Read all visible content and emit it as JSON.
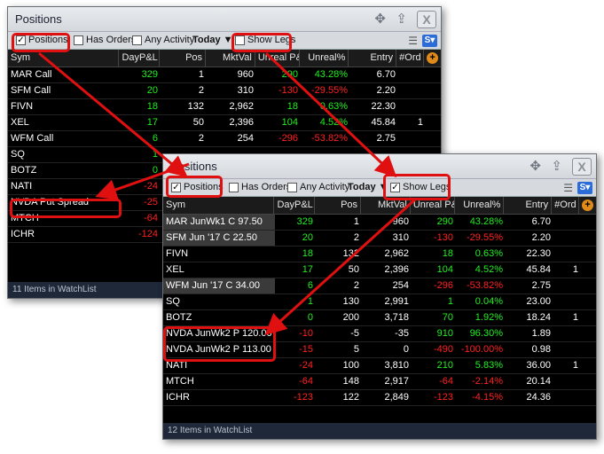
{
  "panels": [
    {
      "title": "Positions",
      "options": {
        "positions": "Positions",
        "has_orders": "Has Orders",
        "any_activity": "Any Activity",
        "today": "Today",
        "show_legs": "Show Legs"
      },
      "columns": [
        "Sym",
        "DayP&L",
        "Pos",
        "MktVal",
        "Unreal P&L",
        "Unreal%",
        "Entry",
        "#Ord"
      ],
      "rows": [
        {
          "sym": "MAR Call",
          "day": "329",
          "pos": "1",
          "mkt": "960",
          "upl": "290",
          "upct": "43.28%",
          "entry": "6.70",
          "ord": ""
        },
        {
          "sym": "SFM Call",
          "day": "20",
          "pos": "2",
          "mkt": "310",
          "upl": "-130",
          "upct": "-29.55%",
          "entry": "2.20",
          "ord": ""
        },
        {
          "sym": "FIVN",
          "day": "18",
          "pos": "132",
          "mkt": "2,962",
          "upl": "18",
          "upct": "0.63%",
          "entry": "22.30",
          "ord": ""
        },
        {
          "sym": "XEL",
          "day": "17",
          "pos": "50",
          "mkt": "2,396",
          "upl": "104",
          "upct": "4.52%",
          "entry": "45.84",
          "ord": "1"
        },
        {
          "sym": "WFM Call",
          "day": "6",
          "pos": "2",
          "mkt": "254",
          "upl": "-296",
          "upct": "-53.82%",
          "entry": "2.75",
          "ord": ""
        },
        {
          "sym": "SQ",
          "day": "1",
          "pos": "",
          "mkt": "",
          "upl": "",
          "upct": "",
          "entry": "",
          "ord": ""
        },
        {
          "sym": "BOTZ",
          "day": "0",
          "pos": "",
          "mkt": "",
          "upl": "",
          "upct": "",
          "entry": "",
          "ord": ""
        },
        {
          "sym": "NATI",
          "day": "-24",
          "pos": "",
          "mkt": "",
          "upl": "",
          "upct": "",
          "entry": "",
          "ord": ""
        },
        {
          "sym": "NVDA Put Spread",
          "day": "-25",
          "pos": "",
          "mkt": "",
          "upl": "",
          "upct": "",
          "entry": "",
          "ord": ""
        },
        {
          "sym": "MTCH",
          "day": "-64",
          "pos": "",
          "mkt": "",
          "upl": "",
          "upct": "",
          "entry": "",
          "ord": ""
        },
        {
          "sym": "ICHR",
          "day": "-124",
          "pos": "",
          "mkt": "",
          "upl": "",
          "upct": "",
          "entry": "",
          "ord": ""
        }
      ],
      "footer": "11 Items in WatchList"
    },
    {
      "title": "Positions",
      "options": {
        "positions": "Positions",
        "has_orders": "Has Orders",
        "any_activity": "Any Activity",
        "today": "Today",
        "show_legs": "Show Legs"
      },
      "columns": [
        "Sym",
        "DayP&L",
        "Pos",
        "MktVal",
        "Unreal P&L",
        "Unreal%",
        "Entry",
        "#Ord"
      ],
      "rows": [
        {
          "sym": "MAR JunWk1 C 97.50",
          "day": "329",
          "pos": "1",
          "mkt": "960",
          "upl": "290",
          "upct": "43.28%",
          "entry": "6.70",
          "ord": ""
        },
        {
          "sym": "SFM Jun '17 C 22.50",
          "day": "20",
          "pos": "2",
          "mkt": "310",
          "upl": "-130",
          "upct": "-29.55%",
          "entry": "2.20",
          "ord": ""
        },
        {
          "sym": "FIVN",
          "day": "18",
          "pos": "132",
          "mkt": "2,962",
          "upl": "18",
          "upct": "0.63%",
          "entry": "22.30",
          "ord": ""
        },
        {
          "sym": "XEL",
          "day": "17",
          "pos": "50",
          "mkt": "2,396",
          "upl": "104",
          "upct": "4.52%",
          "entry": "45.84",
          "ord": "1"
        },
        {
          "sym": "WFM Jun '17 C 34.00",
          "day": "6",
          "pos": "2",
          "mkt": "254",
          "upl": "-296",
          "upct": "-53.82%",
          "entry": "2.75",
          "ord": ""
        },
        {
          "sym": "SQ",
          "day": "1",
          "pos": "130",
          "mkt": "2,991",
          "upl": "1",
          "upct": "0.04%",
          "entry": "23.00",
          "ord": ""
        },
        {
          "sym": "BOTZ",
          "day": "0",
          "pos": "200",
          "mkt": "3,718",
          "upl": "70",
          "upct": "1.92%",
          "entry": "18.24",
          "ord": "1"
        },
        {
          "sym": "NVDA JunWk2 P 120.00",
          "day": "-10",
          "pos": "-5",
          "mkt": "-35",
          "upl": "910",
          "upct": "96.30%",
          "entry": "1.89",
          "ord": ""
        },
        {
          "sym": "NVDA JunWk2 P 113.00",
          "day": "-15",
          "pos": "5",
          "mkt": "0",
          "upl": "-490",
          "upct": "-100.00%",
          "entry": "0.98",
          "ord": ""
        },
        {
          "sym": "NATI",
          "day": "-24",
          "pos": "100",
          "mkt": "3,810",
          "upl": "210",
          "upct": "5.83%",
          "entry": "36.00",
          "ord": "1"
        },
        {
          "sym": "MTCH",
          "day": "-64",
          "pos": "148",
          "mkt": "2,917",
          "upl": "-64",
          "upct": "-2.14%",
          "entry": "20.14",
          "ord": ""
        },
        {
          "sym": "ICHR",
          "day": "-123",
          "pos": "122",
          "mkt": "2,849",
          "upl": "-123",
          "upct": "-4.15%",
          "entry": "24.36",
          "ord": ""
        }
      ],
      "footer": "12 Items in WatchList"
    }
  ],
  "colors": {
    "gain": "#22ee22",
    "loss": "#ff2020",
    "highlight": "#e01010"
  }
}
